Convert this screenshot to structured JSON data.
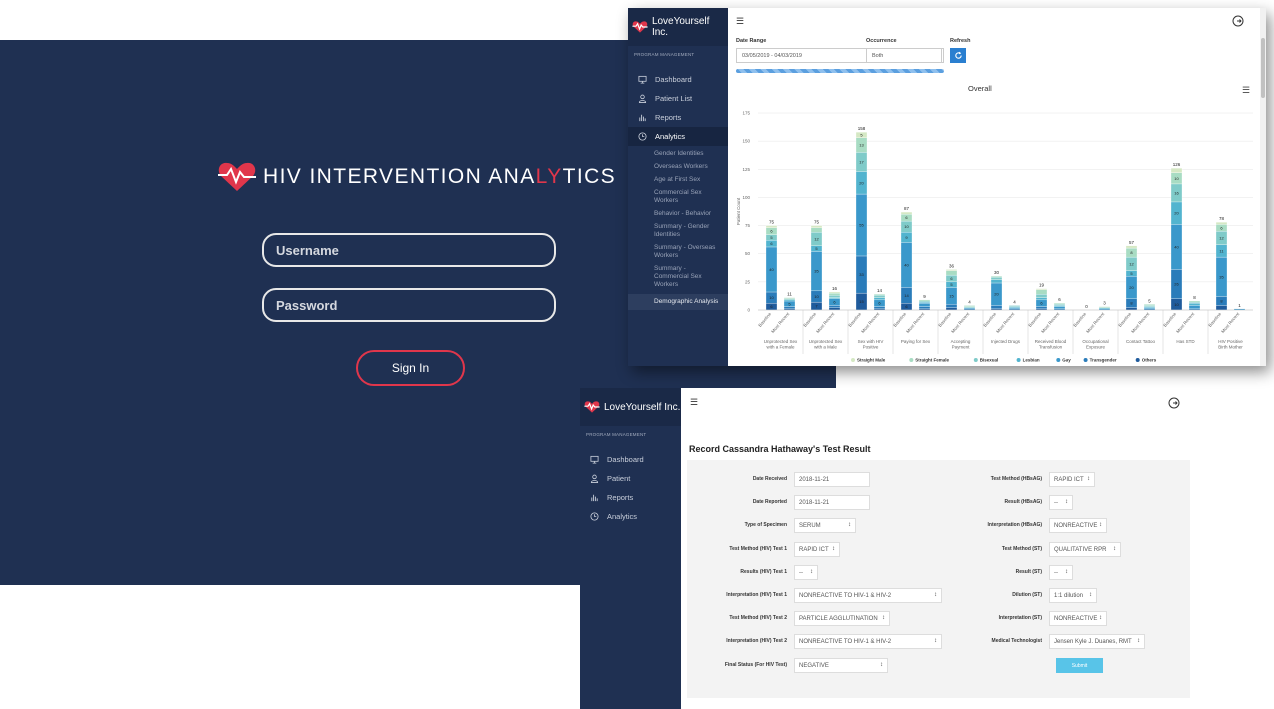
{
  "login": {
    "title_pre": "HIV INTERVENTION ANA",
    "title_highlight": "LY",
    "title_post": "TICS",
    "username_placeholder": "Username",
    "password_placeholder": "Password",
    "signin_label": "Sign In",
    "accent": "#e0364b",
    "background": "#1f3052"
  },
  "app": {
    "brand": "LoveYourself Inc.",
    "subtitle": "PROGRAM MANAGEMENT"
  },
  "analytics": {
    "nav": [
      {
        "label": "Dashboard",
        "icon": "monitor-icon"
      },
      {
        "label": "Patient List",
        "icon": "user-icon"
      },
      {
        "label": "Reports",
        "icon": "bar-chart-icon"
      },
      {
        "label": "Analytics",
        "icon": "clock-icon"
      }
    ],
    "subnav": [
      "Gender Identities",
      "Overseas Workers",
      "Age at First Sex",
      "Commercial Sex Workers",
      "Behavior - Behavior",
      "Summary - Gender Identities",
      "Summary - Overseas Workers",
      "Summary - Commercial Sex Workers",
      "Demographic Analysis"
    ],
    "filters": {
      "date_range_label": "Date Range",
      "date_range_value": "03/05/2019 - 04/03/2019",
      "occurrence_label": "Occurrence",
      "occurrence_value": "Both",
      "refresh_label": "Refresh"
    }
  },
  "chart_data": {
    "type": "bar",
    "title": "Overall",
    "ylabel": "Patient Count",
    "ylim": [
      0,
      175
    ],
    "yticks": [
      0,
      25,
      50,
      75,
      100,
      125,
      150,
      175
    ],
    "groups": [
      "Unprotected Sex with a Female",
      "Unprotected Sex with a Male",
      "Sex with HIV Positive",
      "Paying for Sex",
      "Accepting Payment",
      "Injected Drugs",
      "Received Blood Transfusion",
      "Occupational Exposure",
      "Contact Tattoo",
      "Has STD",
      "HIV Positive Birth Mother"
    ],
    "subcategories": [
      "Baseline",
      "Most Recent"
    ],
    "totals": [
      75,
      11,
      75,
      16,
      158,
      14,
      87,
      9,
      36,
      4,
      30,
      4,
      19,
      6,
      0,
      3,
      57,
      5,
      126,
      8,
      78,
      1
    ],
    "series": [
      {
        "name": "Straight Male",
        "color": "#d5e8c4",
        "values": [
          2,
          0,
          2,
          1,
          5,
          0,
          2,
          0,
          1,
          0,
          0,
          0,
          1,
          0,
          0,
          0,
          2,
          0,
          4,
          0,
          2,
          0
        ]
      },
      {
        "name": "Straight Female",
        "color": "#a8dcc3",
        "values": [
          6,
          1,
          4,
          2,
          13,
          1,
          6,
          1,
          4,
          1,
          1,
          0,
          4,
          1,
          0,
          1,
          8,
          1,
          10,
          1,
          6,
          0
        ]
      },
      {
        "name": "Bisexual",
        "color": "#7fcbc9",
        "values": [
          5,
          1,
          12,
          2,
          17,
          2,
          10,
          1,
          6,
          1,
          2,
          1,
          3,
          1,
          0,
          0,
          12,
          1,
          16,
          1,
          12,
          0
        ]
      },
      {
        "name": "Lesbian",
        "color": "#52b4cf",
        "values": [
          6,
          1,
          5,
          1,
          20,
          2,
          9,
          1,
          5,
          0,
          3,
          1,
          2,
          1,
          0,
          1,
          5,
          1,
          20,
          2,
          11,
          0
        ]
      },
      {
        "name": "Gay",
        "color": "#3a98cb",
        "values": [
          40,
          5,
          35,
          6,
          55,
          6,
          40,
          3,
          15,
          1,
          20,
          1,
          6,
          2,
          0,
          1,
          20,
          1,
          40,
          3,
          35,
          1
        ]
      },
      {
        "name": "Transgender",
        "color": "#2a7cba",
        "values": [
          10,
          2,
          10,
          2,
          33,
          2,
          14,
          2,
          3,
          1,
          3,
          1,
          2,
          1,
          0,
          0,
          8,
          1,
          26,
          1,
          8,
          0
        ]
      },
      {
        "name": "Others",
        "color": "#1f5b9c",
        "values": [
          6,
          1,
          7,
          2,
          15,
          1,
          6,
          1,
          2,
          0,
          1,
          0,
          1,
          0,
          0,
          0,
          2,
          0,
          10,
          0,
          4,
          0
        ]
      }
    ]
  },
  "result": {
    "nav": [
      {
        "label": "Dashboard",
        "icon": "monitor-icon"
      },
      {
        "label": "Patient",
        "icon": "user-icon"
      },
      {
        "label": "Reports",
        "icon": "bar-chart-icon"
      },
      {
        "label": "Analytics",
        "icon": "clock-icon"
      }
    ],
    "title": "Record Cassandra Hathaway's Test Result",
    "left_fields": [
      {
        "label": "Date Received",
        "value": "2018-11-21",
        "select": false,
        "w": 76
      },
      {
        "label": "Date Reported",
        "value": "2018-11-21",
        "select": false,
        "w": 76
      },
      {
        "label": "Type of Specimen",
        "value": "SERUM",
        "select": true,
        "w": 62
      },
      {
        "label": "Test Method (HIV) Test 1",
        "value": "RAPID ICT",
        "select": true,
        "w": 46
      },
      {
        "label": "Results (HIV) Test 1",
        "value": "--",
        "select": true,
        "w": 24
      },
      {
        "label": "Interpretation (HIV) Test 1",
        "value": "NONREACTIVE TO HIV-1 & HIV-2",
        "select": true,
        "w": 148
      },
      {
        "label": "Test Method (HIV) Test 2",
        "value": "PARTICLE AGGLUTINATION",
        "select": true,
        "w": 96
      },
      {
        "label": "Interpretation (HIV) Test 2",
        "value": "NONREACTIVE TO HIV-1 & HIV-2",
        "select": true,
        "w": 148
      },
      {
        "label": "Final Status (For HIV Test)",
        "value": "NEGATIVE",
        "select": true,
        "w": 94
      }
    ],
    "right_fields": [
      {
        "label": "Test Method (HBsAG)",
        "value": "RAPID ICT",
        "select": true,
        "w": 46
      },
      {
        "label": "Result (HBsAG)",
        "value": "--",
        "select": true,
        "w": 24
      },
      {
        "label": "Interpretation (HBsAG)",
        "value": "NONREACTIVE",
        "select": true,
        "w": 58
      },
      {
        "label": "Test Method (ST)",
        "value": "QUALITATIVE RPR",
        "select": true,
        "w": 72
      },
      {
        "label": "Result (ST)",
        "value": "--",
        "select": true,
        "w": 24
      },
      {
        "label": "Dilution (ST)",
        "value": "1:1 dilution",
        "select": true,
        "w": 48
      },
      {
        "label": "Interpretation (ST)",
        "value": "NONREACTIVE",
        "select": true,
        "w": 58
      },
      {
        "label": "Medical Technologist",
        "value": "Jensen Kyle J. Duanes, RMT",
        "select": true,
        "w": 96
      }
    ],
    "submit_label": "Submit"
  }
}
